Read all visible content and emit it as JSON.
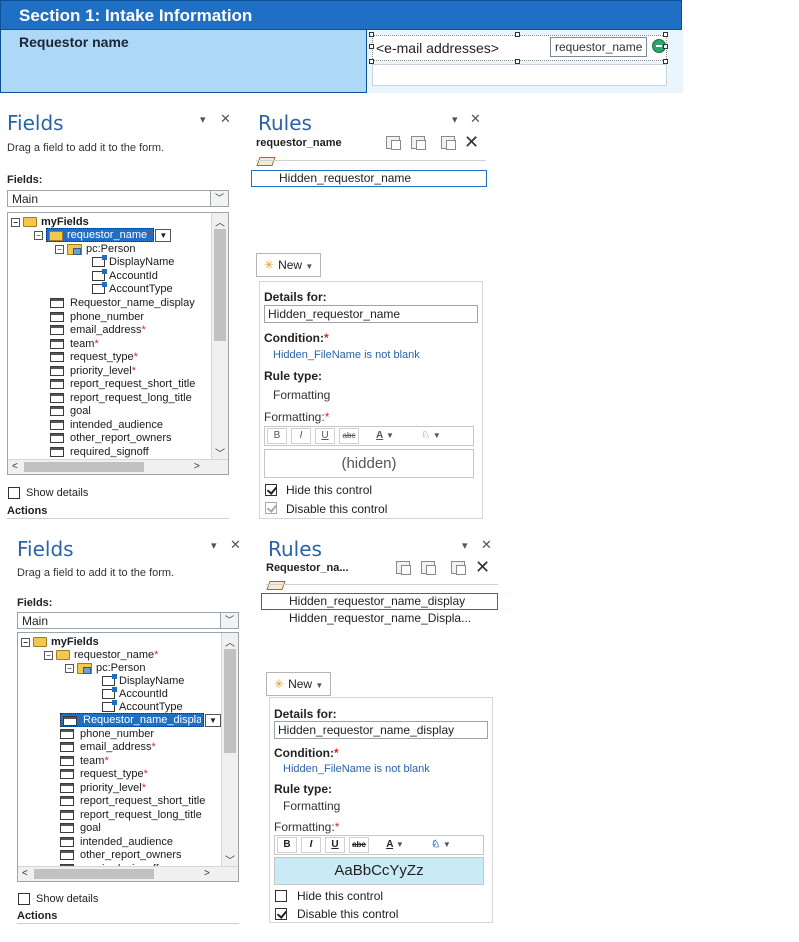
{
  "form": {
    "section_title": "Section 1: Intake Information",
    "field_label": "Requestor name",
    "picker_placeholder": "<e-mail addresses>",
    "picker_tag": "requestor_name"
  },
  "panes": [
    {
      "fields": {
        "title": "Fields",
        "hint": "Drag a field to add it to the form.",
        "fields_label": "Fields:",
        "source_value": "Main",
        "tree": {
          "root": "myFields",
          "requestor_name": "requestor_name",
          "person": "pc:Person",
          "display_name": "DisplayName",
          "account_id": "AccountId",
          "account_type": "AccountType",
          "items": [
            {
              "label": "Requestor_name_display",
              "required": false
            },
            {
              "label": "phone_number",
              "required": false
            },
            {
              "label": "email_address",
              "required": true
            },
            {
              "label": "team",
              "required": true
            },
            {
              "label": "request_type",
              "required": true
            },
            {
              "label": "priority_level",
              "required": true
            },
            {
              "label": "report_request_short_title",
              "required": false
            },
            {
              "label": "report_request_long_title",
              "required": false
            },
            {
              "label": "goal",
              "required": false
            },
            {
              "label": "intended_audience",
              "required": false
            },
            {
              "label": "other_report_owners",
              "required": false
            },
            {
              "label": "required_signoff",
              "required": false
            }
          ]
        },
        "show_details": "Show details",
        "actions": "Actions"
      },
      "rules": {
        "title": "Rules",
        "field_name": "requestor_name",
        "rules_list": [
          "Hidden_requestor_name"
        ],
        "new_label": "New",
        "details_label": "Details for:",
        "details_value": "Hidden_requestor_name",
        "condition_label": "Condition:",
        "condition_value": "Hidden_FileName is not blank",
        "rule_type_label": "Rule type:",
        "rule_type_value": "Formatting",
        "formatting_label": "Formatting:",
        "preview": "(hidden)",
        "hide_label": "Hide this control",
        "hide_checked": true,
        "disable_label": "Disable this control",
        "disable_checked": true
      }
    },
    {
      "fields": {
        "title": "Fields",
        "hint": "Drag a field to add it to the form.",
        "fields_label": "Fields:",
        "source_value": "Main",
        "tree": {
          "root": "myFields",
          "requestor_name": "requestor_name",
          "person": "pc:Person",
          "display_name": "DisplayName",
          "account_id": "AccountId",
          "account_type": "AccountType",
          "items": [
            {
              "label": "Requestor_name_display",
              "required": false
            },
            {
              "label": "phone_number",
              "required": false
            },
            {
              "label": "email_address",
              "required": true
            },
            {
              "label": "team",
              "required": true
            },
            {
              "label": "request_type",
              "required": true
            },
            {
              "label": "priority_level",
              "required": true
            },
            {
              "label": "report_request_short_title",
              "required": false
            },
            {
              "label": "report_request_long_title",
              "required": false
            },
            {
              "label": "goal",
              "required": false
            },
            {
              "label": "intended_audience",
              "required": false
            },
            {
              "label": "other_report_owners",
              "required": false
            },
            {
              "label": "required_signoff",
              "required": false
            }
          ]
        },
        "show_details": "Show details",
        "actions": "Actions"
      },
      "rules": {
        "title": "Rules",
        "field_name": "Requestor_na...",
        "rules_list": [
          "Hidden_requestor_name_display",
          "Hidden_requestor_name_Displa..."
        ],
        "new_label": "New",
        "details_label": "Details for:",
        "details_value": "Hidden_requestor_name_display",
        "condition_label": "Condition:",
        "condition_value": "Hidden_FileName is not blank",
        "rule_type_label": "Rule type:",
        "rule_type_value": "Formatting",
        "formatting_label": "Formatting:",
        "preview": "AaBbCcYyZz",
        "hide_label": "Hide this control",
        "hide_checked": false,
        "disable_label": "Disable this control",
        "disable_checked": true
      }
    }
  ],
  "format_buttons": {
    "bold": "B",
    "italic": "I",
    "underline": "U",
    "strike": "abc"
  },
  "colors": {
    "accent": "#1f6fc5",
    "section_body": "#aed8f7",
    "required": "#d62b2b",
    "link": "#2a63a8"
  }
}
